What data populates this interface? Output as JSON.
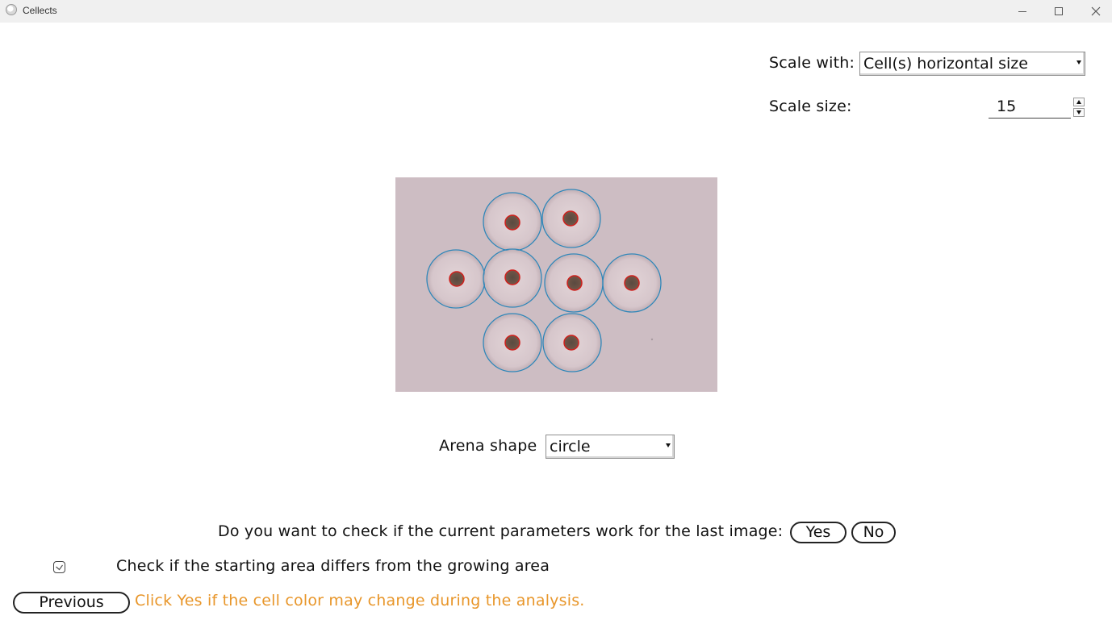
{
  "window": {
    "title": "Cellects",
    "icon": "cellects-app-icon",
    "controls": [
      "minimize",
      "maximize",
      "close"
    ]
  },
  "scale": {
    "with_label": "Scale with:",
    "with_value": "Cell(s) horizontal size",
    "size_label": "Scale size:",
    "size_value": "15"
  },
  "preview": {
    "description_icon": "arena-detection-preview",
    "background_color": "#cdbdc3",
    "arena_outline_color": "#2f86b8",
    "cell_outline_color": "#d0201c",
    "arena_count": 8
  },
  "arena": {
    "shape_label": "Arena shape",
    "shape_value": "circle"
  },
  "last_image_check": {
    "question": "Do you want to check if the current parameters work for the last image:",
    "yes_label": "Yes",
    "no_label": "No"
  },
  "starting_area": {
    "checkbox_label": "Check if the starting area differs from the growing area",
    "checked": false
  },
  "footer": {
    "previous_label": "Previous",
    "hint_text": "Click Yes if the cell color may change during the analysis.",
    "hint_color": "#e8962a"
  }
}
